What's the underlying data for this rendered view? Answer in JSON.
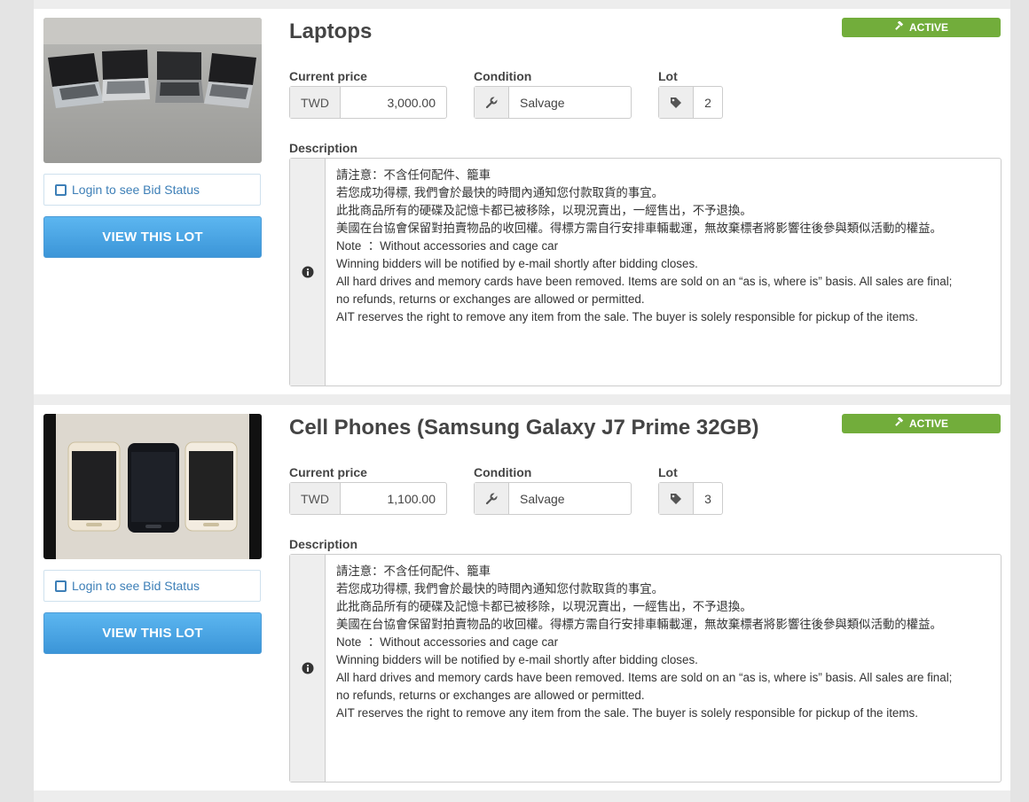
{
  "lots": [
    {
      "title": "Laptops",
      "badge": "ACTIVE",
      "bid_status": "Login to see Bid Status",
      "view_button": "VIEW THIS LOT",
      "price_label": "Current price",
      "currency": "TWD",
      "price": "3,000.00",
      "condition_label": "Condition",
      "condition": "Salvage",
      "lot_label": "Lot",
      "lot_number": "2",
      "description_label": "Description",
      "description": [
        "請注意：不含任何配件、籠車",
        "",
        "若您成功得標, 我們會於最快的時間內通知您付款取貨的事宜。",
        "此批商品所有的硬碟及記憶卡都已被移除，以現況賣出，一經售出，不予退換。",
        "美國在台協會保留對拍賣物品的收回權。得標方需自行安排車輛載運，無故棄標者將影響往後參與類似活動的權益。",
        "",
        "Note  ：Without accessories and cage car",
        "",
        "Winning bidders will be notified by e-mail shortly after bidding closes.",
        "All hard drives and memory cards have been removed. Items are sold on an “as is, where is” basis. All sales are final;",
        "no refunds, returns or exchanges are allowed or permitted.",
        "AIT reserves the right to remove any item from the sale. The buyer is solely responsible for pickup of the items."
      ]
    },
    {
      "title": "Cell Phones (Samsung Galaxy J7 Prime 32GB)",
      "badge": "ACTIVE",
      "bid_status": "Login to see Bid Status",
      "view_button": "VIEW THIS LOT",
      "price_label": "Current price",
      "currency": "TWD",
      "price": "1,100.00",
      "condition_label": "Condition",
      "condition": "Salvage",
      "lot_label": "Lot",
      "lot_number": "3",
      "description_label": "Description",
      "description": [
        "請注意：不含任何配件、籠車",
        "",
        "若您成功得標, 我們會於最快的時間內通知您付款取貨的事宜。",
        "此批商品所有的硬碟及記憶卡都已被移除，以現況賣出，一經售出，不予退換。",
        "美國在台協會保留對拍賣物品的收回權。得標方需自行安排車輛載運，無故棄標者將影響往後參與類似活動的權益。",
        "",
        "Note  ：Without accessories and cage car",
        "",
        "Winning bidders will be notified by e-mail shortly after bidding closes.",
        "All hard drives and memory cards have been removed. Items are sold on an “as is, where is” basis. All sales are final;",
        "no refunds, returns or exchanges are allowed or permitted.",
        "AIT reserves the right to remove any item from the sale. The buyer is solely responsible for pickup of the items."
      ]
    }
  ],
  "icons": {
    "badge": "gavel-icon",
    "checkbox": "square-checkbox-icon",
    "condition": "wrench-icon",
    "lot": "tag-icon",
    "description": "info-icon"
  },
  "colors": {
    "badge_green": "#72ad3b",
    "button_blue": "#4aa6e6",
    "link_blue": "#3d7fb7"
  }
}
